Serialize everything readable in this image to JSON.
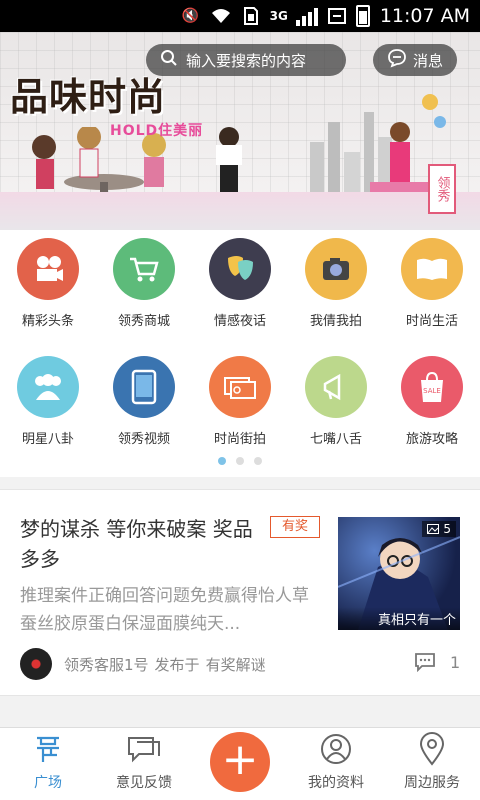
{
  "status": {
    "time": "11:07 AM",
    "network": "3G"
  },
  "banner": {
    "logo_text": "品味时尚",
    "logo_sub": "HOLD住美丽",
    "tag": "领秀"
  },
  "search": {
    "placeholder": "输入要搜索的内容"
  },
  "header": {
    "message_label": "消息"
  },
  "categories": [
    {
      "label": "精彩头条",
      "icon": "movie-camera-icon",
      "color": "#e2624a"
    },
    {
      "label": "领秀商城",
      "icon": "shopping-cart-icon",
      "color": "#5dbb7a"
    },
    {
      "label": "情感夜话",
      "icon": "theater-masks-icon",
      "color": "#3e3d4f"
    },
    {
      "label": "我倩我拍",
      "icon": "camera-icon",
      "color": "#f0b84b"
    },
    {
      "label": "时尚生活",
      "icon": "open-book-icon",
      "color": "#f2b84e"
    },
    {
      "label": "明星八卦",
      "icon": "people-icon",
      "color": "#6fcbe0"
    },
    {
      "label": "领秀视频",
      "icon": "tablet-icon",
      "color": "#3a74b0"
    },
    {
      "label": "时尚街拍",
      "icon": "ticket-icon",
      "color": "#f07a47"
    },
    {
      "label": "七嘴八舌",
      "icon": "megaphone-icon",
      "color": "#bcd88c"
    },
    {
      "label": "旅游攻略",
      "icon": "sale-bag-icon",
      "color": "#ea5a6a"
    }
  ],
  "pager": {
    "count": 3,
    "active": 0
  },
  "post": {
    "title": "梦的谋杀 等你来破案 奖品多多",
    "badge": "有奖",
    "description": "推理案件正确回答问题免费赢得怡人草蚕丝胶原蛋白保湿面膜纯天...",
    "image_count": "5",
    "image_caption": "真相只有一个",
    "author": "领秀客服1号",
    "published_in": "发布于",
    "board": "有奖解谜",
    "comments": "1"
  },
  "tabs": [
    {
      "label": "广场",
      "icon": "plaza-icon",
      "active": true
    },
    {
      "label": "意见反馈",
      "icon": "feedback-icon",
      "active": false
    },
    {
      "label": "",
      "icon": "plus-icon",
      "active": false
    },
    {
      "label": "我的资料",
      "icon": "profile-icon",
      "active": false
    },
    {
      "label": "周边服务",
      "icon": "location-pin-icon",
      "active": false
    }
  ],
  "colors": {
    "accent": "#3a8fd1",
    "plus_button": "#f06a3e",
    "badge": "#e4592d"
  }
}
